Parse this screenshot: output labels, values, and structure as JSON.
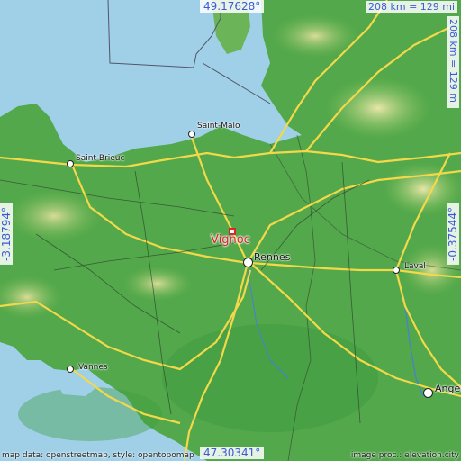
{
  "target": {
    "name": "Vignoc",
    "color": "#e0222a"
  },
  "coordinates": {
    "top_lat": "49.17628°",
    "bottom_lat": "47.30341°",
    "left_lon": "-3.18794°",
    "right_lon": "-0.37544°"
  },
  "scale": {
    "horizontal": "208 km = 129 mi",
    "vertical": "208 km = 129 mi"
  },
  "cities": [
    {
      "name": "Saint-Malo"
    },
    {
      "name": "Saint-Brieuc"
    },
    {
      "name": "Rennes"
    },
    {
      "name": "Laval"
    },
    {
      "name": "Vannes"
    },
    {
      "name": "Angers"
    }
  ],
  "attribution": {
    "left": "map data: openstreetmap, style: opentopomap",
    "right": "image proc.: elevation.city"
  },
  "colors": {
    "sea": "#9fd0e8",
    "land": "#52a84a",
    "highland": "#c9d98a",
    "motorway": "#f3d84a",
    "coord_text": "#3b5bd6"
  }
}
